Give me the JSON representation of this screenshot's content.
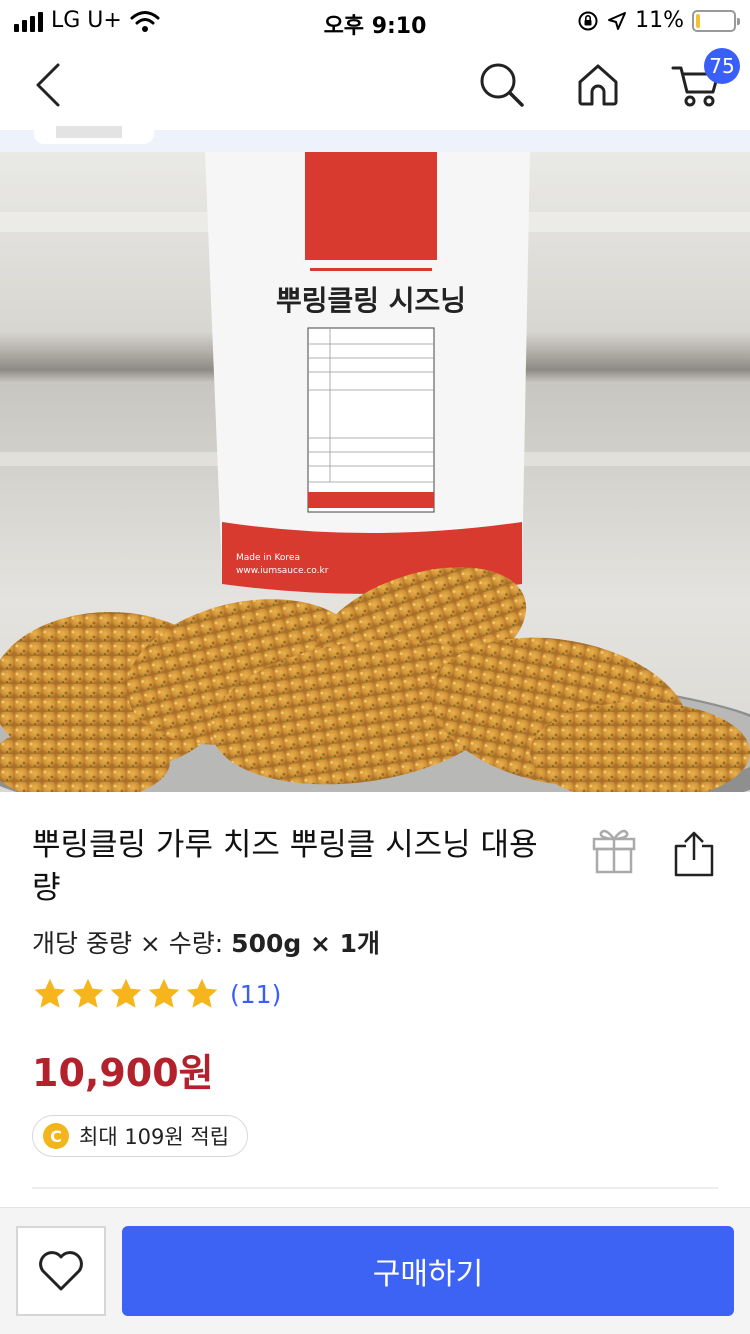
{
  "status_bar": {
    "carrier": "LG U+",
    "time": "오후 9:10",
    "battery": "11%",
    "battery_level": 0.11,
    "icons": [
      "signal-icon",
      "wifi-icon",
      "orientation-lock-icon",
      "location-arrow-icon",
      "battery-icon"
    ]
  },
  "nav": {
    "icons": [
      "back-icon",
      "search-icon",
      "home-icon",
      "cart-icon"
    ],
    "cart_count": "75"
  },
  "product": {
    "image_text": {
      "package_title": "뿌링클링 시즈닝",
      "made_in": "Made in Korea",
      "website": "www.iumsauce.co.kr"
    },
    "title": "뿌링클링 가루 치즈 뿌링클 시즈닝 대용량",
    "unit_label": "개당 중량 × 수량: ",
    "unit_value": "500g × 1개",
    "rating": 5,
    "review_count": "(11)",
    "price": "10,900원",
    "points_badge": "C",
    "points_text": "최대 109원 적립",
    "icons": [
      "gift-icon",
      "share-icon",
      "star-icon"
    ]
  },
  "bottom_bar": {
    "buy_label": "구매하기",
    "icons": [
      "heart-icon"
    ]
  },
  "colors": {
    "accent_blue": "#3d63f5",
    "price_red": "#b3212c",
    "star_yellow": "#f6b51c",
    "coin_yellow": "#f2b51c",
    "package_red": "#d93a30"
  }
}
